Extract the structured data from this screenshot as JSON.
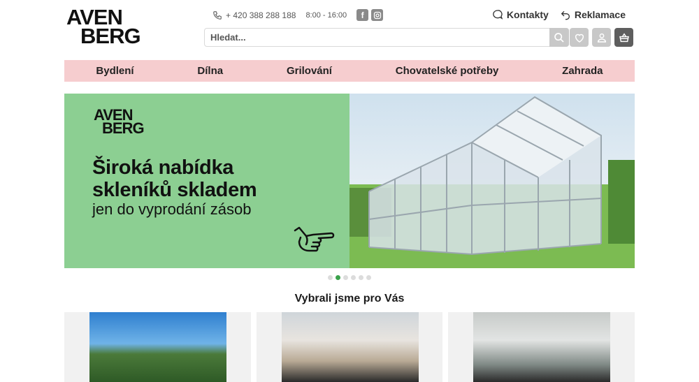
{
  "logo": {
    "line1": "AVEN",
    "line2": "BERG"
  },
  "contact": {
    "phone": "+ 420 388 288 188",
    "hours": "8:00 - 16:00"
  },
  "social": {
    "facebook": "f",
    "instagram": "ig"
  },
  "toplinks": {
    "contacts": "Kontakty",
    "complaints": "Reklamace"
  },
  "search": {
    "placeholder": "Hledat..."
  },
  "nav": [
    "Bydlení",
    "Dílna",
    "Grilování",
    "Chovatelské potřeby",
    "Zahrada"
  ],
  "banner": {
    "logo_line1": "AVEN",
    "logo_line2": "BERG",
    "headline_line1": "Široká nabídka",
    "headline_line2": "skleníků skladem",
    "subline": "jen do vyprodání zásob"
  },
  "carousel": {
    "count": 6,
    "active_index": 1
  },
  "section": {
    "title": "Vybrali jsme pro Vás"
  },
  "colors": {
    "nav_bg": "#f6cdcf",
    "banner_green": "#8ccf92",
    "active_dot": "#3aa24b",
    "icon_btn": "#c8c8c8"
  }
}
